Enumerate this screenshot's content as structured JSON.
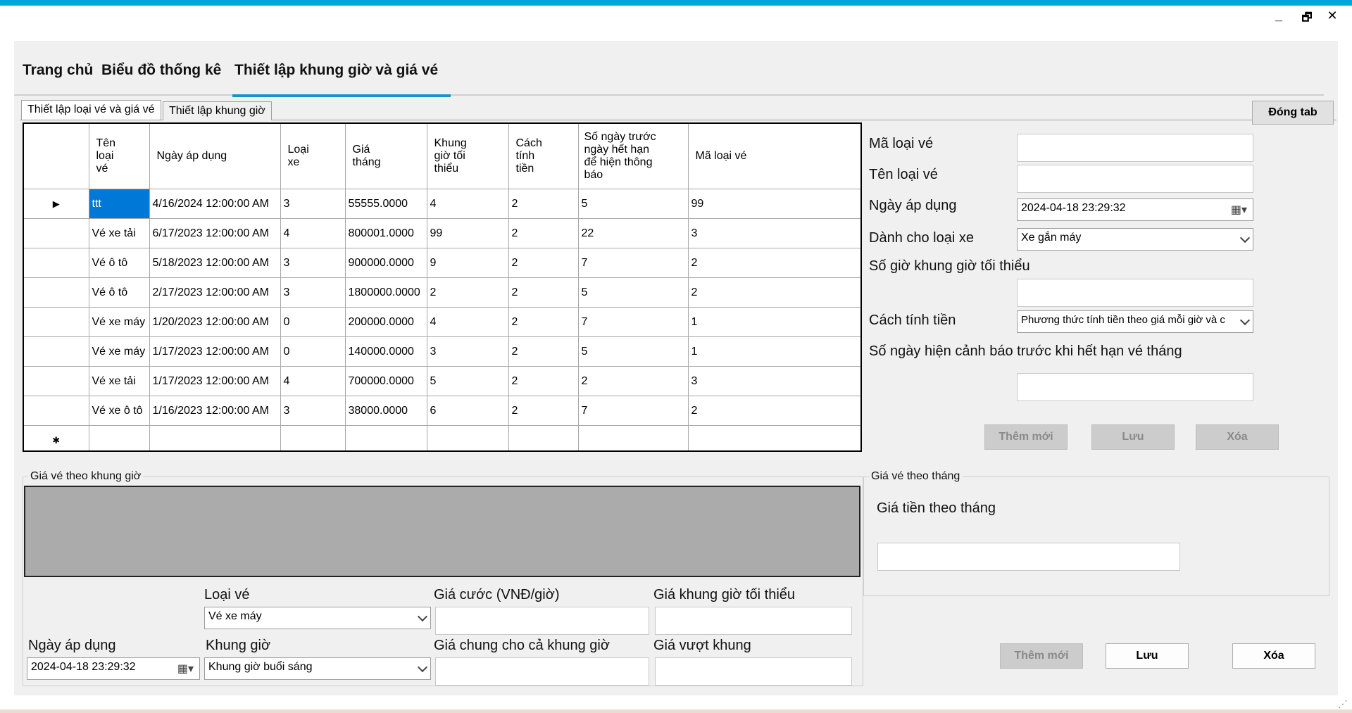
{
  "window": {
    "minimize_glyph": "_",
    "restore_glyph": "🗗",
    "close_glyph": "✕"
  },
  "menu": {
    "items": [
      "Trang chủ",
      "Biểu đồ thống kê",
      "Thiết lập khung giờ và giá vé"
    ],
    "active_index": 2
  },
  "tabs": {
    "items": [
      "Thiết lập loại vé và giá vé",
      "Thiết lập khung giờ"
    ],
    "close_label": "Đóng tab"
  },
  "grid": {
    "columns": [
      "Tên loại vé",
      "Ngày áp dụng",
      "Loại xe",
      "Giá tháng",
      "Khung giờ tối thiểu",
      "Cách tính tiền",
      "Số ngày trước ngày hết hạn để hiện thông báo",
      "Mã loại vé"
    ],
    "rows": [
      [
        "ttt",
        "4/16/2024 12:00:00 AM",
        "3",
        "55555.0000",
        "4",
        "2",
        "5",
        "99"
      ],
      [
        "Vé xe tải",
        "6/17/2023 12:00:00 AM",
        "4",
        "800001.0000",
        "99",
        "2",
        "22",
        "3"
      ],
      [
        "Vé ô tô",
        "5/18/2023 12:00:00 AM",
        "3",
        "900000.0000",
        "9",
        "2",
        "7",
        "2"
      ],
      [
        "Vé ô tô",
        "2/17/2023 12:00:00 AM",
        "3",
        "1800000.0000",
        "2",
        "2",
        "5",
        "2"
      ],
      [
        "Vé xe máy",
        "1/20/2023 12:00:00 AM",
        "0",
        "200000.0000",
        "4",
        "2",
        "7",
        "1"
      ],
      [
        "Vé xe máy",
        "1/17/2023 12:00:00 AM",
        "0",
        "140000.0000",
        "3",
        "2",
        "5",
        "1"
      ],
      [
        "Vé xe tải",
        "1/17/2023 12:00:00 AM",
        "4",
        "700000.0000",
        "5",
        "2",
        "2",
        "3"
      ],
      [
        "Vé xe ô tô",
        "1/16/2023 12:00:00 AM",
        "3",
        "38000.0000",
        "6",
        "2",
        "7",
        "2"
      ]
    ],
    "current_row_glyph": "▶",
    "new_row_glyph": "✱"
  },
  "form": {
    "ma_loai_ve_label": "Mã loại vé",
    "ten_loai_ve_label": "Tên loại vé",
    "ngay_ap_dung_label": "Ngày áp dụng",
    "ngay_ap_dung_value": "2024-04-18 23:29:32",
    "danh_cho_loai_xe_label": "Dành cho loại xe",
    "danh_cho_loai_xe_value": "Xe gắn máy",
    "so_gio_label": "Số giờ khung giờ tối thiểu",
    "cach_tinh_tien_label": "Cách tính tiền",
    "cach_tinh_tien_value": "Phương thức tính tiền theo giá mỗi giờ và c",
    "so_ngay_label": "Số ngày hiện cảnh báo trước khi hết hạn vé tháng",
    "btn_them_moi": "Thêm mới",
    "btn_luu": "Lưu",
    "btn_xoa": "Xóa"
  },
  "khung_gio": {
    "group_title": "Giá vé theo khung giờ",
    "loai_ve_label": "Loại vé",
    "loai_ve_value": "Vé xe máy",
    "gia_cuoc_label": "Giá cước (VNĐ/giờ)",
    "gia_khung_toi_thieu_label": "Giá khung giờ tối thiểu",
    "ngay_ap_dung_label": "Ngày áp dụng",
    "ngay_ap_dung_value": "2024-04-18 23:29:32",
    "khung_gio_label": "Khung giờ",
    "khung_gio_value": "Khung giờ buổi sáng",
    "gia_chung_label": "Giá chung cho cả khung giờ",
    "gia_vuot_khung_label": "Giá vượt khung"
  },
  "theo_thang": {
    "group_title": "Giá vé theo tháng",
    "gia_tien_label": "Giá tiền theo tháng",
    "btn_them_moi": "Thêm mới",
    "btn_luu": "Lưu",
    "btn_xoa": "Xóa"
  },
  "colors": {
    "title_bar": "#00a6d6",
    "selection": "#0078d7",
    "active_tab_underline": "#1e90c8",
    "gray_area": "#ababab"
  }
}
